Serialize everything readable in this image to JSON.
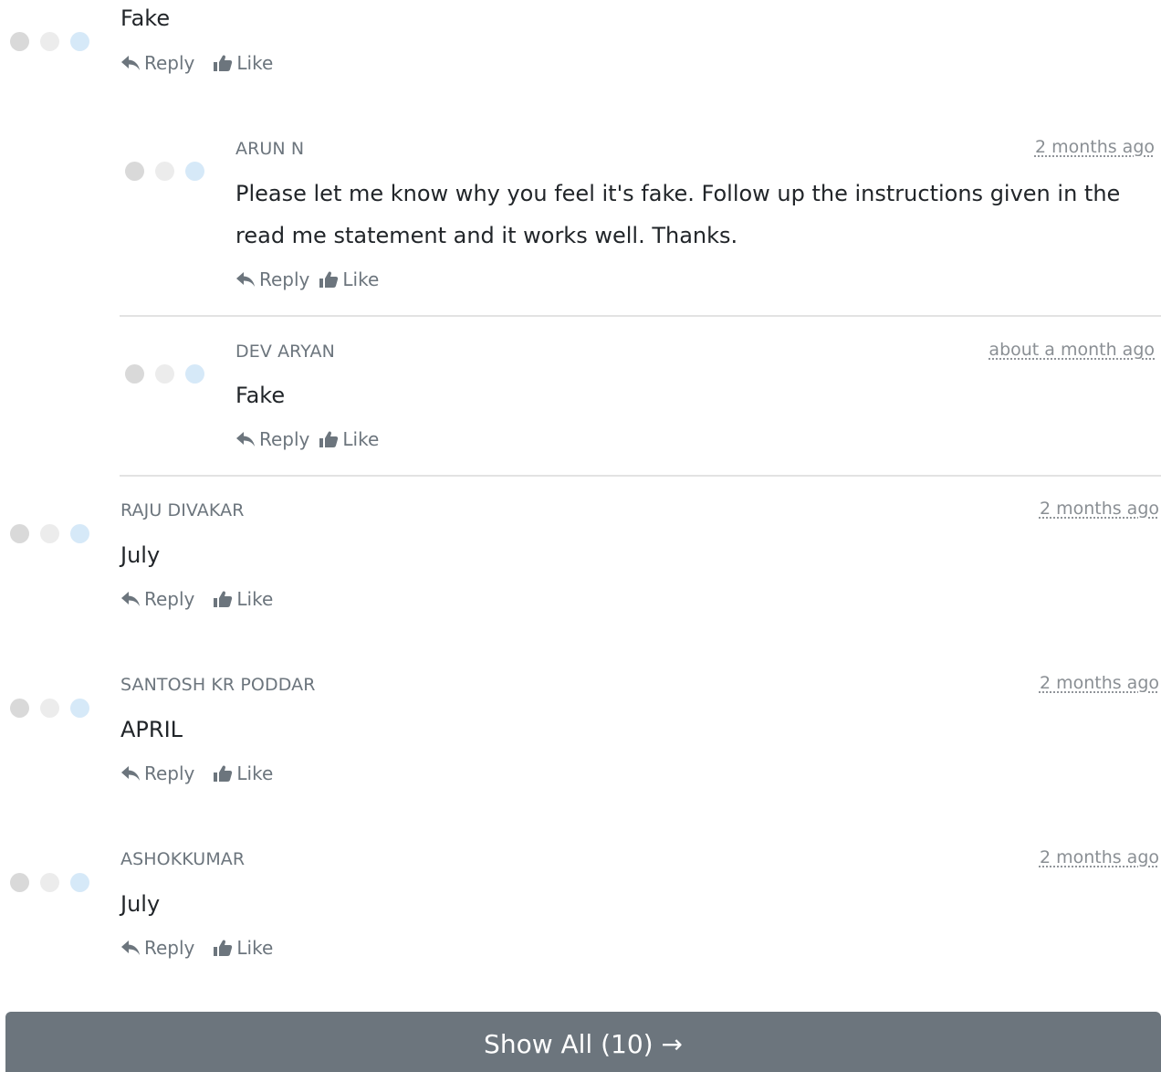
{
  "comments": [
    {
      "author": "",
      "time": "",
      "text": "Fake",
      "reply_label": "Reply",
      "like_label": "Like"
    },
    {
      "author": "ARUN N",
      "time": "2 months ago",
      "text": "Please let me know why you feel it's fake. Follow up the instructions given in the read me statement and it works well. Thanks.",
      "reply_label": "Reply",
      "like_label": "Like"
    },
    {
      "author": "DEV ARYAN",
      "time": "about a month ago",
      "text": "Fake",
      "reply_label": "Reply",
      "like_label": "Like"
    },
    {
      "author": "RAJU DIVAKAR",
      "time": "2 months ago",
      "text": "July",
      "reply_label": "Reply",
      "like_label": "Like"
    },
    {
      "author": "SANTOSH KR PODDAR",
      "time": "2 months ago",
      "text": "APRIL",
      "reply_label": "Reply",
      "like_label": "Like"
    },
    {
      "author": "ASHOKKUMAR",
      "time": "2 months ago",
      "text": "July",
      "reply_label": "Reply",
      "like_label": "Like"
    }
  ],
  "show_all_label": "Show All (10) →",
  "colors": {
    "button_bg": "#6c757d",
    "muted_text": "#6c757d",
    "avatar_dot_1": "#d9d9d9",
    "avatar_dot_2": "#ececec",
    "avatar_dot_3": "#d6e9f8"
  },
  "icons": {
    "reply": "reply-arrow-icon",
    "like": "thumbs-up-icon"
  }
}
